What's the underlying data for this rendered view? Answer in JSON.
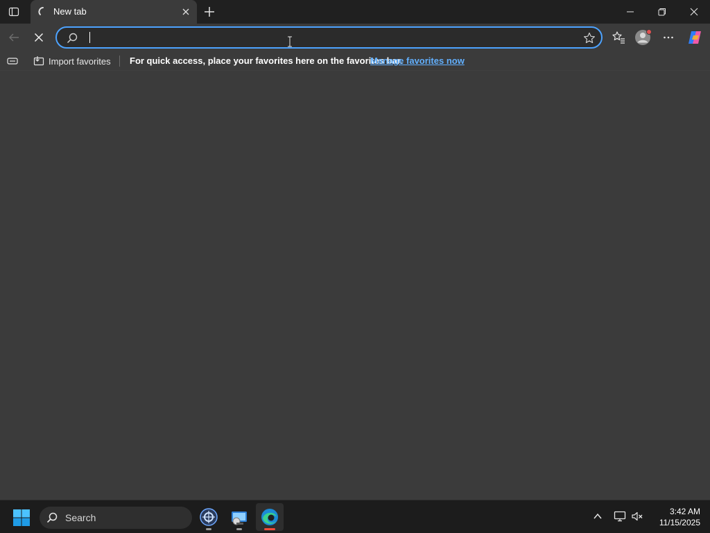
{
  "browser": {
    "tab": {
      "title": "New tab"
    },
    "address_bar": {
      "value": "",
      "placeholder": ""
    }
  },
  "favorites_bar": {
    "import_label": "Import favorites",
    "message": "For quick access, place your favorites here on the favorites bar.",
    "manage_link": "Manage favorites now"
  },
  "taskbar": {
    "search_label": "Search",
    "time": "3:42 AM",
    "date": "11/15/2025"
  },
  "colors": {
    "accent": "#4da3ff",
    "link": "#62b0ff",
    "content_bg": "#3b3b3b",
    "titlebar_bg": "#202020",
    "taskbar_bg": "#1c1c1c"
  },
  "icons": [
    "tab-actions-icon",
    "loading-spinner-icon",
    "close-tab-icon",
    "new-tab-icon",
    "minimize-icon",
    "restore-icon",
    "close-window-icon",
    "back-icon",
    "stop-loading-icon",
    "search-icon",
    "favorite-star-icon",
    "favorites-icon",
    "profile-icon",
    "more-icon",
    "copilot-icon",
    "favorites-bar-icon",
    "import-favorites-icon",
    "windows-start-icon",
    "taskbar-search-icon",
    "app-icon",
    "app-icon",
    "edge-icon",
    "show-hidden-icons-icon",
    "network-icon",
    "volume-muted-icon"
  ]
}
